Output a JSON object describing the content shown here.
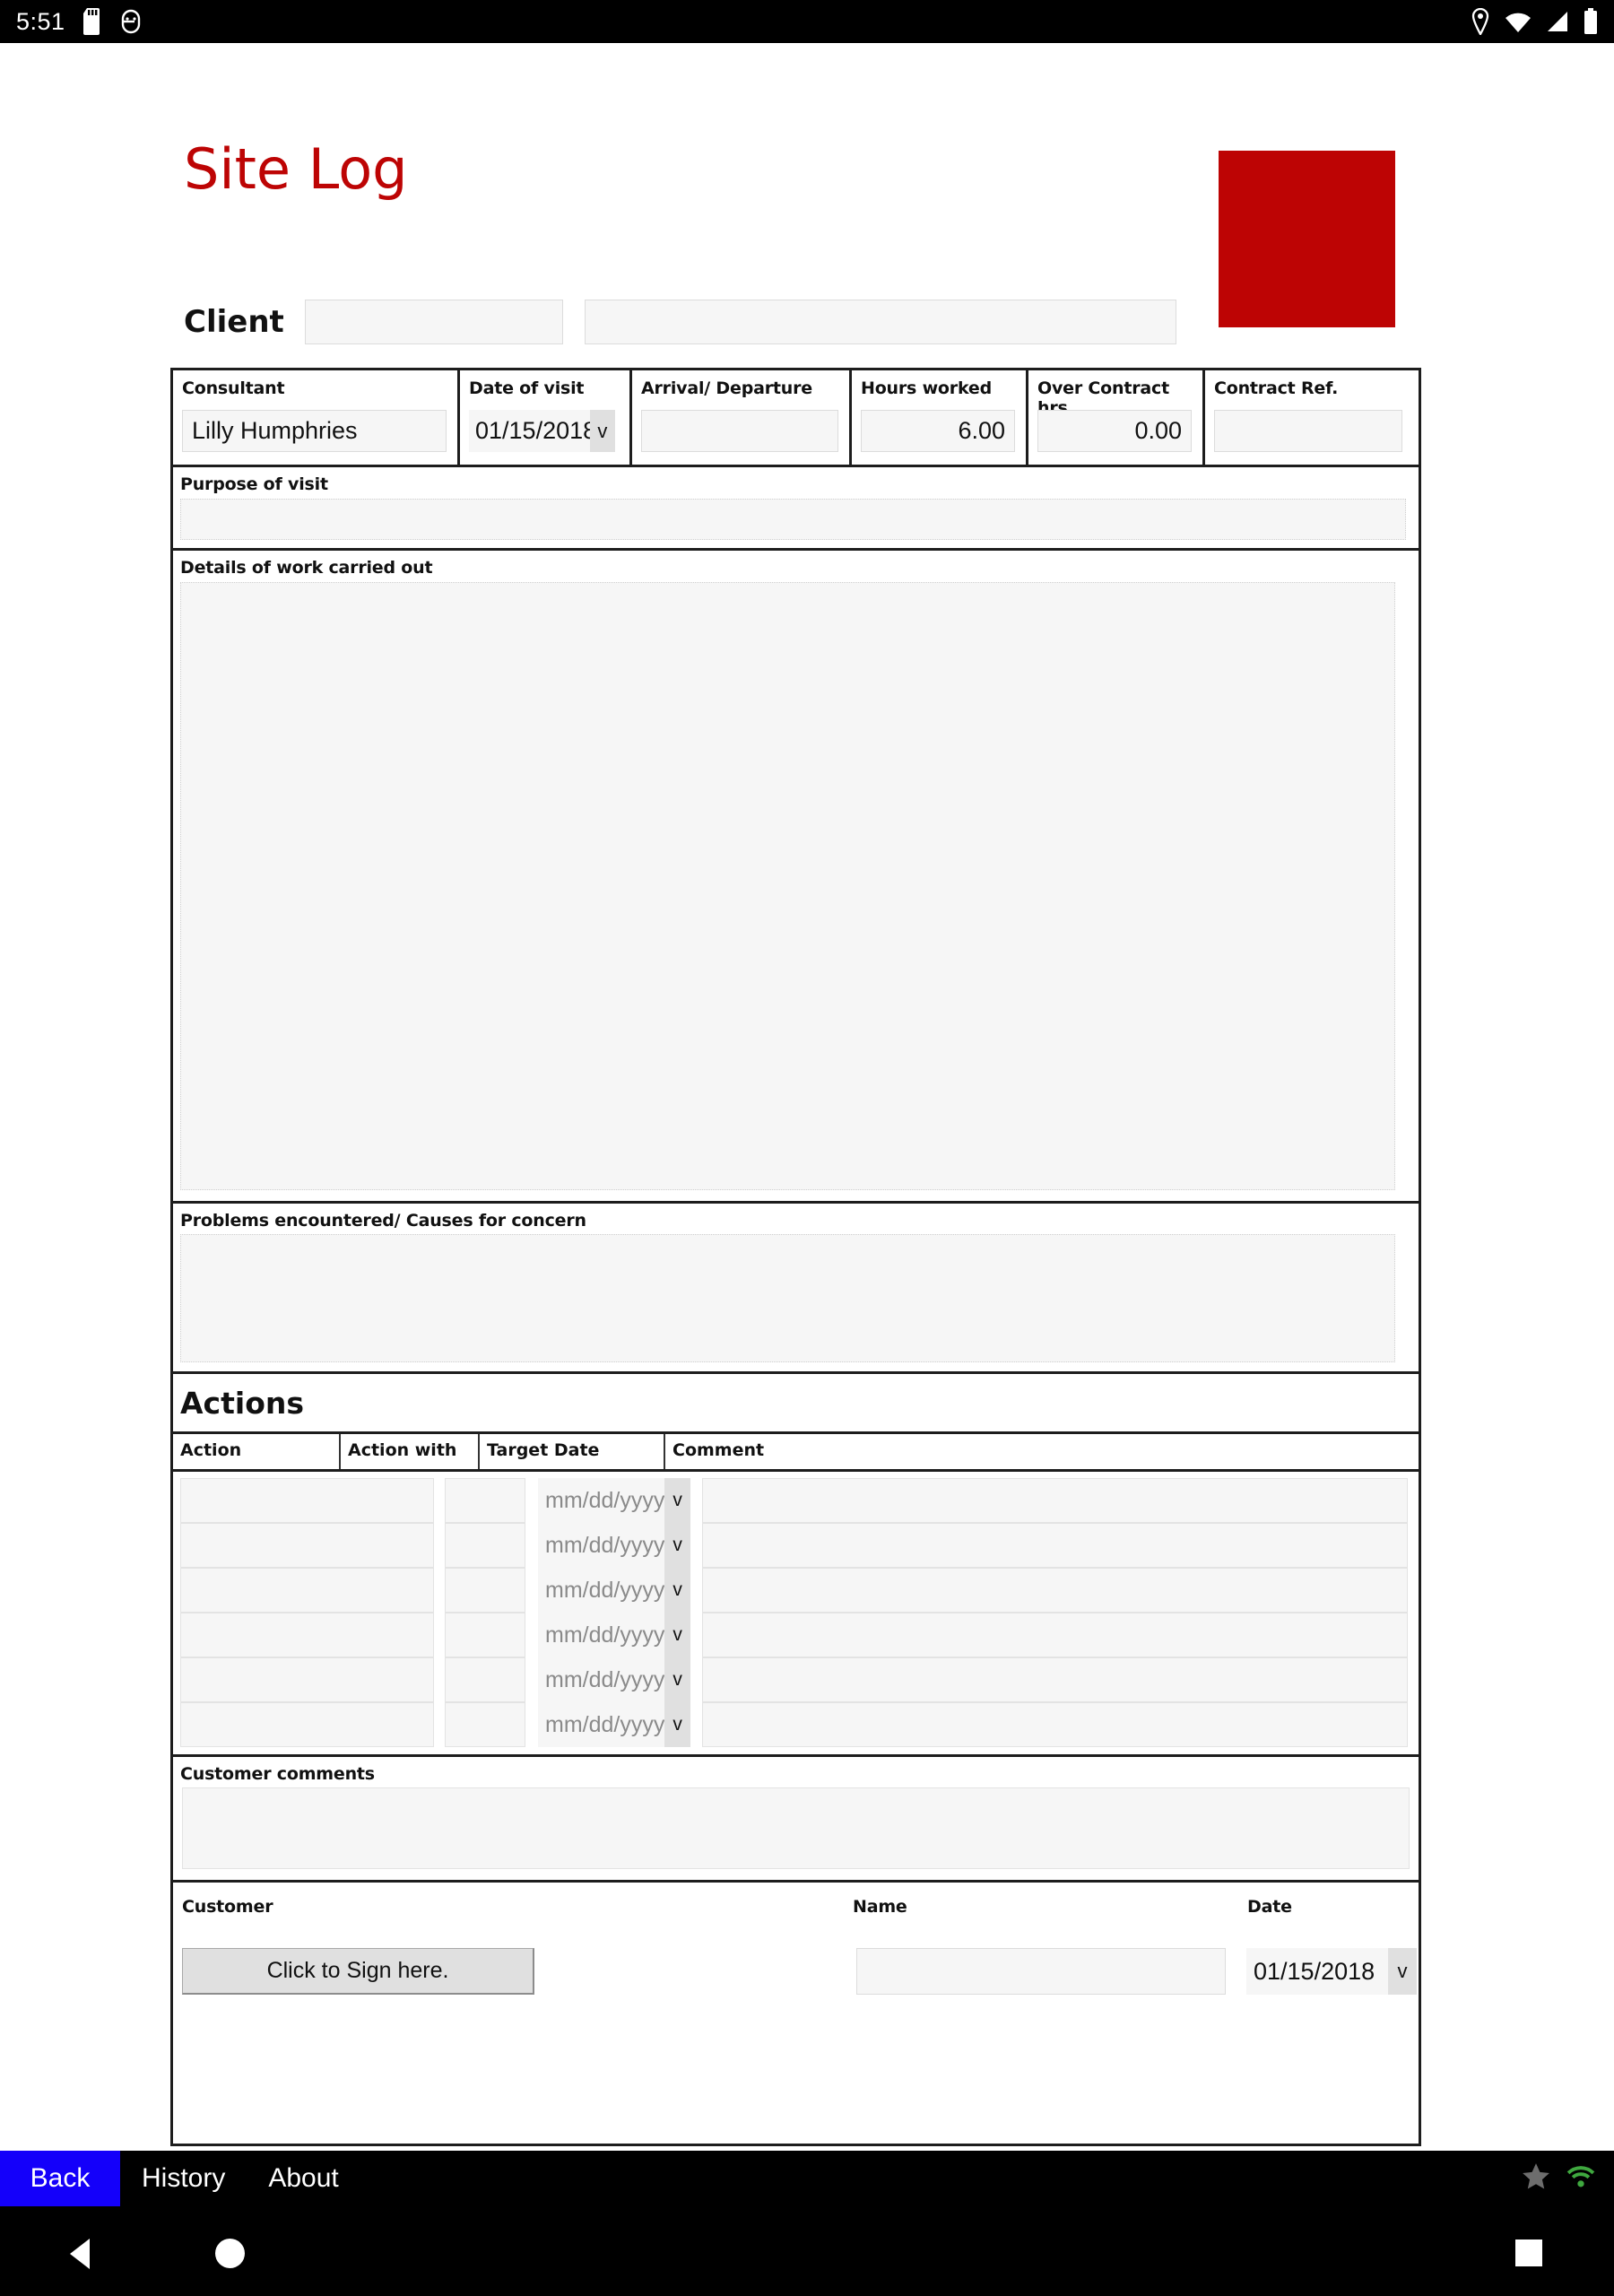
{
  "status_bar": {
    "time": "5:51",
    "left_icons": [
      "sd-card-icon",
      "android-head-icon"
    ],
    "right_icons": [
      "location-pin-icon",
      "wifi-icon",
      "cellular-signal-icon",
      "battery-icon"
    ]
  },
  "document": {
    "title": "Site Log",
    "title_color": "#bd0404",
    "logo_color": "#bd0404",
    "client": {
      "label": "Client",
      "field1_value": "",
      "field2_value": ""
    },
    "info_row": {
      "consultant": {
        "label": "Consultant",
        "value": "Lilly Humphries"
      },
      "date_of_visit": {
        "label": "Date  of visit",
        "value": "01/15/2018",
        "caret": "v"
      },
      "arrival_departure": {
        "label": "Arrival/ Departure",
        "value": ""
      },
      "hours_worked": {
        "label": "Hours worked",
        "value": "6.00"
      },
      "over_contract_hrs": {
        "label": "Over Contract hrs",
        "value": "0.00"
      },
      "contract_ref": {
        "label": "Contract Ref.",
        "value": ""
      }
    },
    "purpose_of_visit": {
      "label": "Purpose of visit",
      "value": ""
    },
    "details_of_work": {
      "label": "Details of work carried out",
      "value": ""
    },
    "problems": {
      "label": "Problems encountered/ Causes for concern",
      "value": ""
    },
    "actions": {
      "heading": "Actions",
      "columns": [
        "Action",
        "Action with",
        "Target Date",
        "Comment"
      ],
      "date_placeholder": "mm/dd/yyyy",
      "caret": "v",
      "rows": [
        {
          "action": "",
          "action_with": "",
          "target_date": "",
          "comment": ""
        },
        {
          "action": "",
          "action_with": "",
          "target_date": "",
          "comment": ""
        },
        {
          "action": "",
          "action_with": "",
          "target_date": "",
          "comment": ""
        },
        {
          "action": "",
          "action_with": "",
          "target_date": "",
          "comment": ""
        },
        {
          "action": "",
          "action_with": "",
          "target_date": "",
          "comment": ""
        },
        {
          "action": "",
          "action_with": "",
          "target_date": "",
          "comment": ""
        }
      ]
    },
    "customer_comments": {
      "label": "Customer comments",
      "value": ""
    },
    "signature": {
      "customer_label": "Customer",
      "name_label": "Name",
      "date_label": "Date",
      "sign_button": "Click to Sign here.",
      "name_value": "",
      "date_value": "01/15/2018",
      "caret": "v"
    }
  },
  "app_nav": {
    "back": "Back",
    "history": "History",
    "about": "About",
    "right_icons": [
      "star-icon",
      "wifi-status-icon"
    ],
    "back_bg": "#1400fa",
    "wifi_color": "#3fa83f",
    "star_color": "#6d6d6d"
  },
  "system_nav": {
    "back": "back-triangle-icon",
    "home": "home-circle-icon",
    "recents": "recents-square-icon"
  }
}
